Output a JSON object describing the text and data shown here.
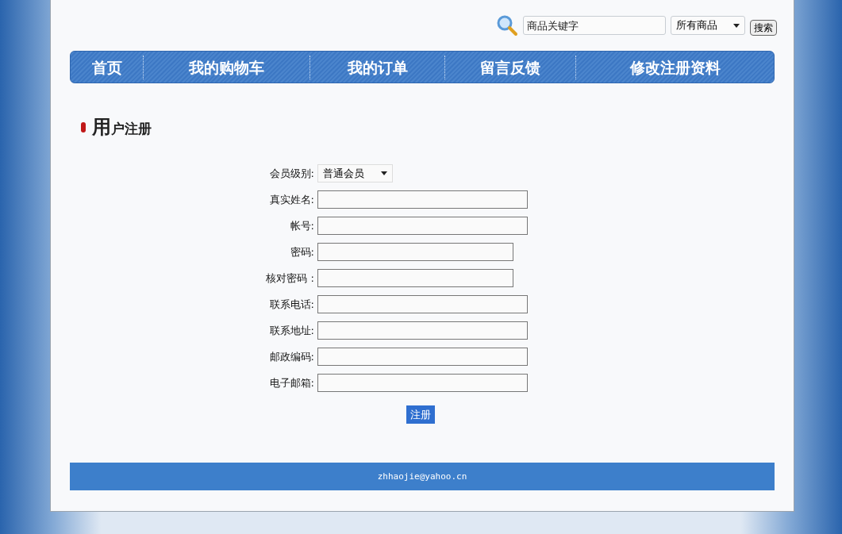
{
  "search": {
    "placeholder": "商品关键字",
    "category": "所有商品",
    "button": "搜索"
  },
  "nav": [
    {
      "label": "首页"
    },
    {
      "label": "我的购物车"
    },
    {
      "label": "我的订单"
    },
    {
      "label": "留言反馈"
    },
    {
      "label": "修改注册资料"
    }
  ],
  "title": "用户注册",
  "form": {
    "fields": [
      {
        "label": "会员级别:",
        "kind": "select",
        "value": "普通会员"
      },
      {
        "label": "真实姓名:",
        "kind": "text"
      },
      {
        "label": "帐号:",
        "kind": "text"
      },
      {
        "label": "密码:",
        "kind": "password"
      },
      {
        "label": "核对密码 :",
        "kind": "password"
      },
      {
        "label": "联系电话:",
        "kind": "text"
      },
      {
        "label": "联系地址:",
        "kind": "text"
      },
      {
        "label": "邮政编码:",
        "kind": "text"
      },
      {
        "label": "电子邮箱:",
        "kind": "text"
      }
    ],
    "submit": "注册"
  },
  "footer": "zhhaojie@yahoo.cn"
}
